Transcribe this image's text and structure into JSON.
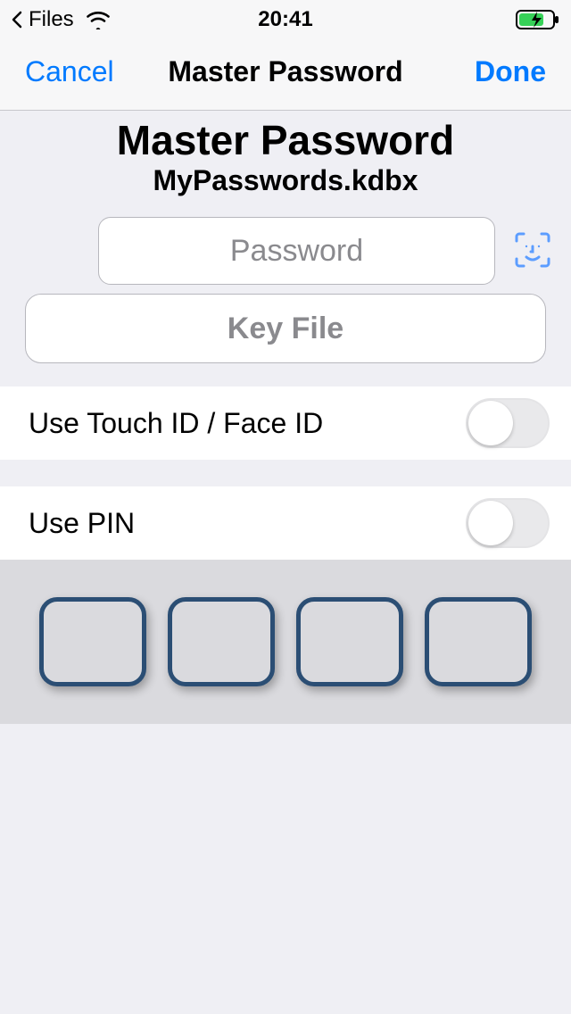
{
  "status": {
    "back_app": "Files",
    "time": "20:41"
  },
  "nav": {
    "cancel": "Cancel",
    "title": "Master Password",
    "done": "Done"
  },
  "header": {
    "title": "Master Password",
    "filename": "MyPasswords.kdbx"
  },
  "form": {
    "password_placeholder": "Password",
    "password_value": "",
    "keyfile_label": "Key File"
  },
  "settings": {
    "biometric_label": "Use Touch ID / Face ID",
    "biometric_on": false,
    "pin_label": "Use PIN",
    "pin_on": false
  },
  "pin": {
    "digits": [
      "",
      "",
      "",
      ""
    ]
  },
  "colors": {
    "accent": "#007aff",
    "pin_border": "#2b4e74"
  }
}
